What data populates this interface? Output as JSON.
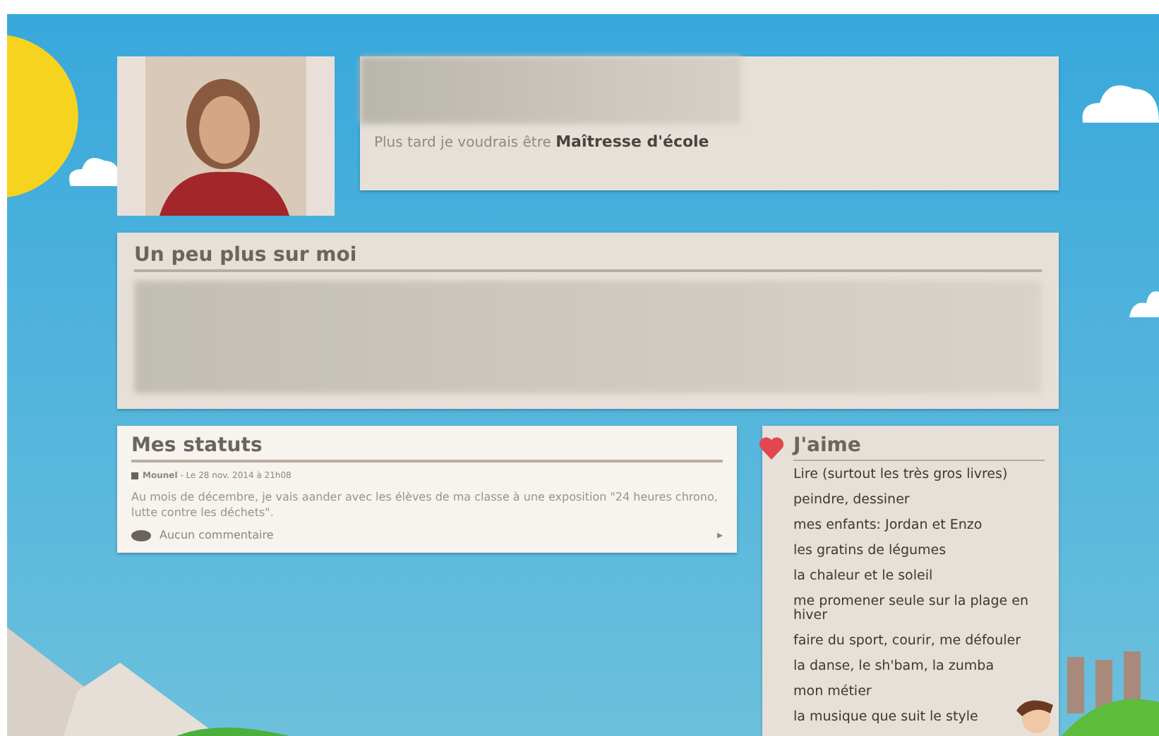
{
  "profile": {
    "tagline": "Plus tard je voudrais être **Maîtresse d'école**"
  },
  "about": {
    "title": "Un peu plus sur moi"
  },
  "statuses": {
    "title": "Mes statuts",
    "posts": [
      {
        "author": "Mounel",
        "date": "- Le 28 nov. 2014 à 21h08",
        "text": "Au mois de décembre, je vais aander avec les élèves de ma classe à une exposition \"24 heures chrono, lutte contre les déchets\".",
        "comments": "Aucun commentaire",
        "more": "▸"
      }
    ]
  },
  "likes": {
    "title": "J'aime",
    "items": [
      "Lire (surtout les très gros livres)",
      "peindre, dessiner",
      "mes enfants: Jordan et Enzo",
      "les gratins de légumes",
      "la chaleur et le soleil",
      "me promener seule sur la plage en hiver",
      "faire du sport, courir, me défouler",
      "la danse, le sh'bam, la zumba",
      "mon métier",
      "la musique que suit le style"
    ]
  }
}
